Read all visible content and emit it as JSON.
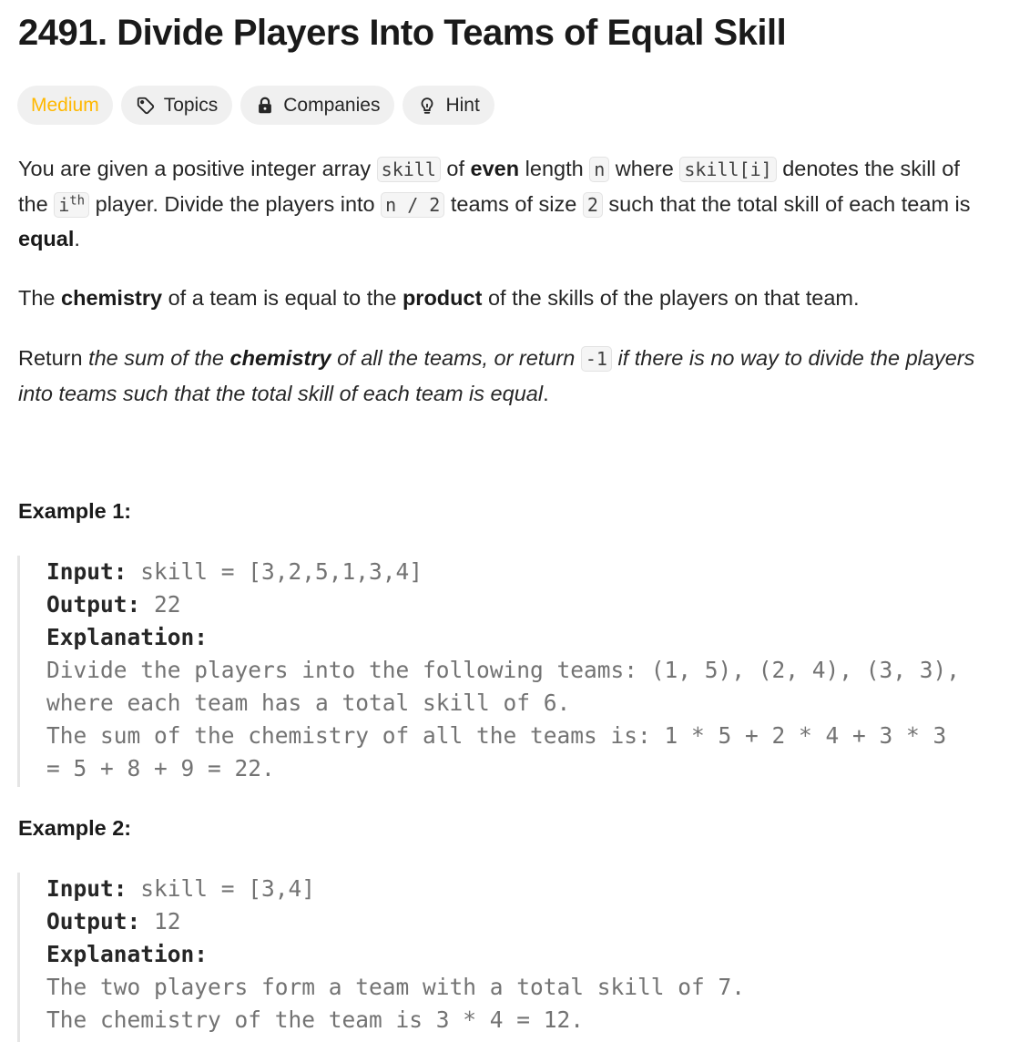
{
  "problem": {
    "title": "2491. Divide Players Into Teams of Equal Skill"
  },
  "tags": {
    "difficulty": "Medium",
    "topics": "Topics",
    "companies": "Companies",
    "hint": "Hint",
    "difficulty_color": "#ffb800"
  },
  "description": {
    "p1": {
      "t1": "You are given a positive integer array ",
      "c1": "skill",
      "t2": " of ",
      "b1": "even",
      "t3": " length ",
      "c2": "n",
      "t4": " where ",
      "c3": "skill[i]",
      "t5": " denotes the skill of the ",
      "c4": "i",
      "sup": "th",
      "t6": " player. Divide the players into ",
      "c5": "n / 2",
      "t7": " teams of size ",
      "c6": "2",
      "t8": " such that the total skill of each team is ",
      "b2": "equal",
      "t9": "."
    },
    "p2": {
      "t1": "The ",
      "b1": "chemistry",
      "t2": " of a team is equal to the ",
      "b2": "product",
      "t3": " of the skills of the players on that team."
    },
    "p3": {
      "t1": "Return ",
      "i1": "the sum of the ",
      "b1": "chemistry",
      "i2": " of all the teams, or return ",
      "c1": "-1",
      "i3": " if there is no way to divide the players into teams such that the total skill of each team is equal",
      "t2": "."
    }
  },
  "examples": [
    {
      "heading": "Example 1:",
      "input_label": "Input:",
      "input_value": " skill = [3,2,5,1,3,4]",
      "output_label": "Output:",
      "output_value": " 22",
      "explanation_label": "Explanation:",
      "explanation_lines": [
        "Divide the players into the following teams: (1, 5), (2, 4), (3, 3),",
        "where each team has a total skill of 6.",
        "The sum of the chemistry of all the teams is: 1 * 5 + 2 * 4 + 3 * 3",
        "= 5 + 8 + 9 = 22."
      ]
    },
    {
      "heading": "Example 2:",
      "input_label": "Input:",
      "input_value": " skill = [3,4]",
      "output_label": "Output:",
      "output_value": " 12",
      "explanation_label": "Explanation:",
      "explanation_lines": [
        "The two players form a team with a total skill of 7.",
        "The chemistry of the team is 3 * 4 = 12."
      ]
    }
  ]
}
